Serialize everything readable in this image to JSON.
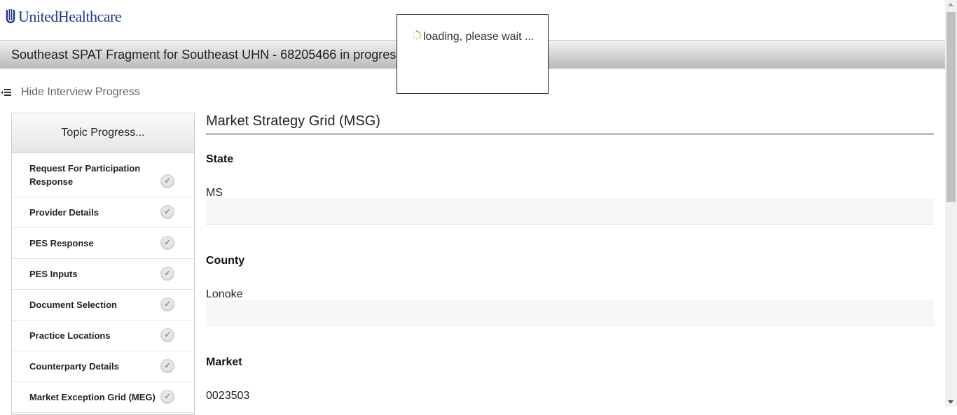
{
  "brand": {
    "name": "UnitedHealthcare",
    "color": "#1a3a8a"
  },
  "header": {
    "title": "Southeast SPAT Fragment for Southeast UHN - 68205466 in progress"
  },
  "progress_toggle": {
    "label": "Hide Interview Progress",
    "icon": "menu-collapse-icon"
  },
  "topic_panel": {
    "header": "Topic Progress...",
    "items": [
      {
        "label": "Request For Participation Response",
        "icon": "check-icon"
      },
      {
        "label": "Provider Details",
        "icon": "check-icon"
      },
      {
        "label": "PES Response",
        "icon": "check-icon"
      },
      {
        "label": "PES Inputs",
        "icon": "check-icon"
      },
      {
        "label": "Document Selection",
        "icon": "check-icon"
      },
      {
        "label": "Practice Locations",
        "icon": "check-icon"
      },
      {
        "label": "Counterparty Details",
        "icon": "check-icon"
      },
      {
        "label": "Market Exception Grid (MEG)",
        "icon": "check-icon"
      }
    ]
  },
  "main": {
    "title": "Market Strategy Grid (MSG)",
    "fields": [
      {
        "label": "State",
        "value": "MS"
      },
      {
        "label": "County",
        "value": "Lonoke"
      },
      {
        "label": "Market",
        "value": "0023503"
      }
    ]
  },
  "loading": {
    "text": "loading, please wait ...",
    "icon": "spinner-icon"
  }
}
